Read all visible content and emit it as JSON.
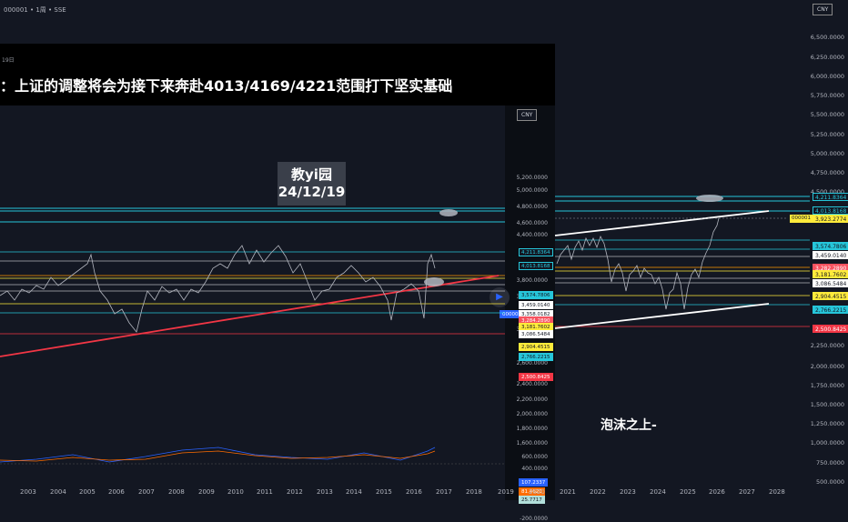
{
  "header": {
    "symbol": "000001",
    "interval": "1周",
    "exchange": "SSE",
    "sep": "•"
  },
  "currency": "CNY",
  "inset": {
    "date_fragment": "19日",
    "title": "：上证的调整将会为接下来奔赴4013/4169/4221范围打下坚实基础",
    "stamp_name": "教yi园",
    "stamp_date": "24/12/19",
    "currency": "CNY",
    "axis": [
      "5,200.0000",
      "5,000.0000",
      "4,800.0000",
      "4,600.0000",
      "4,400.0000",
      "3,800.0000",
      "3,600.0000",
      "3,000.0000",
      "2,600.0000",
      "2,400.0000",
      "2,200.0000",
      "2,000.0000",
      "1,800.0000",
      "1,600.0000",
      "600.0000",
      "400.0000",
      "200.0000",
      "-200.0000"
    ],
    "tags": [
      {
        "text": "4,211.8364",
        "bg": "#131722",
        "fg": "#26c6da",
        "border": "#26c6da"
      },
      {
        "text": "4,013.8168",
        "bg": "#131722",
        "fg": "#26c6da",
        "border": "#26c6da"
      },
      {
        "text": "3,574.7806",
        "bg": "#26c6da",
        "fg": "#131722",
        "border": "#26c6da"
      },
      {
        "text": "3,459.0140",
        "bg": "#ffffff",
        "fg": "#131722",
        "border": "#ffffff"
      },
      {
        "text": "000001",
        "bg": "#2962ff",
        "fg": "#ffffff",
        "border": "#2962ff"
      },
      {
        "text": "3,358.0182",
        "bg": "#ffffff",
        "fg": "#131722",
        "border": "#ffffff"
      },
      {
        "text": "3,284.2890",
        "bg": "#f7525f",
        "fg": "#ffffff",
        "border": "#f7525f"
      },
      {
        "text": "3,181.7602",
        "bg": "#ffeb3b",
        "fg": "#131722",
        "border": "#ffeb3b"
      },
      {
        "text": "3,086.5484",
        "bg": "#ffffff",
        "fg": "#131722",
        "border": "#ffffff"
      },
      {
        "text": "2,904.4515",
        "bg": "#ffeb3b",
        "fg": "#131722",
        "border": "#ffeb3b"
      },
      {
        "text": "2,766.2215",
        "bg": "#26c6da",
        "fg": "#131722",
        "border": "#26c6da"
      },
      {
        "text": "2,500.8425",
        "bg": "#f23645",
        "fg": "#ffffff",
        "border": "#f23645"
      },
      {
        "text": "107.2337",
        "bg": "#2962ff",
        "fg": "#ffffff",
        "border": "#2962ff"
      },
      {
        "text": "81.4620",
        "bg": "#ff6d00",
        "fg": "#ffffff",
        "border": "#ff6d00"
      },
      {
        "text": "25.7717",
        "bg": "#b2dfdb",
        "fg": "#131722",
        "border": "#b2dfdb"
      }
    ]
  },
  "main_axis": [
    "6,500.0000",
    "6,250.0000",
    "6,000.0000",
    "5,750.0000",
    "5,500.0000",
    "5,250.0000",
    "5,000.0000",
    "4,750.0000",
    "4,500.0000",
    "2,250.0000",
    "2,000.0000",
    "1,750.0000",
    "1,500.0000",
    "1,250.0000",
    "1,000.0000",
    "750.0000",
    "500.0000"
  ],
  "main_tags": [
    {
      "text": "4,211.8364",
      "bg": "#131722",
      "fg": "#26c6da",
      "border": "#26c6da"
    },
    {
      "text": "4,013.8168",
      "bg": "#131722",
      "fg": "#26c6da",
      "border": "#26c6da"
    },
    {
      "text": "3,923.2774",
      "bg": "#ffeb3b",
      "fg": "#131722",
      "border": "#ffeb3b"
    },
    {
      "text": "3,574.7806",
      "bg": "#26c6da",
      "fg": "#131722",
      "border": "#26c6da"
    },
    {
      "text": "3,459.0140",
      "bg": "#ffffff",
      "fg": "#131722",
      "border": "#ffffff"
    },
    {
      "text": "3,282.2890",
      "bg": "#f7525f",
      "fg": "#ffffff",
      "border": "#f7525f"
    },
    {
      "text": "3,181.7602",
      "bg": "#ffeb3b",
      "fg": "#131722",
      "border": "#ffeb3b"
    },
    {
      "text": "3,086.5484",
      "bg": "#ffffff",
      "fg": "#131722",
      "border": "#ffffff"
    },
    {
      "text": "2,904.4515",
      "bg": "#ffeb3b",
      "fg": "#131722",
      "border": "#ffeb3b"
    },
    {
      "text": "2,766.2215",
      "bg": "#26c6da",
      "fg": "#131722",
      "border": "#26c6da"
    },
    {
      "text": "2,500.8425",
      "bg": "#f23645",
      "fg": "#ffffff",
      "border": "#f23645"
    }
  ],
  "main_symbol_tag": "000001",
  "annotation": "泡沫之上-",
  "years": [
    "2003",
    "2004",
    "2005",
    "2006",
    "2007",
    "2008",
    "2009",
    "2010",
    "2011",
    "2012",
    "2013",
    "2014",
    "2015",
    "2016",
    "2017",
    "2018",
    "2019",
    "2020",
    "2021",
    "2022",
    "2023",
    "2024",
    "2025",
    "2026",
    "2027",
    "2028"
  ]
}
